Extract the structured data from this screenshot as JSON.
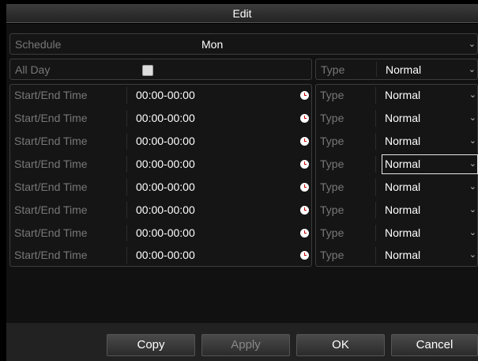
{
  "dialog": {
    "title": "Edit"
  },
  "schedule": {
    "label": "Schedule",
    "value": "Mon"
  },
  "allday": {
    "label": "All Day",
    "checked": false,
    "type_label": "Type",
    "type_value": "Normal"
  },
  "rows": [
    {
      "label": "Start/End Time",
      "time": "00:00-00:00",
      "type_label": "Type",
      "type_value": "Normal"
    },
    {
      "label": "Start/End Time",
      "time": "00:00-00:00",
      "type_label": "Type",
      "type_value": "Normal"
    },
    {
      "label": "Start/End Time",
      "time": "00:00-00:00",
      "type_label": "Type",
      "type_value": "Normal"
    },
    {
      "label": "Start/End Time",
      "time": "00:00-00:00",
      "type_label": "Type",
      "type_value": "Normal"
    },
    {
      "label": "Start/End Time",
      "time": "00:00-00:00",
      "type_label": "Type",
      "type_value": "Normal"
    },
    {
      "label": "Start/End Time",
      "time": "00:00-00:00",
      "type_label": "Type",
      "type_value": "Normal"
    },
    {
      "label": "Start/End Time",
      "time": "00:00-00:00",
      "type_label": "Type",
      "type_value": "Normal"
    },
    {
      "label": "Start/End Time",
      "time": "00:00-00:00",
      "type_label": "Type",
      "type_value": "Normal"
    }
  ],
  "buttons": {
    "copy": "Copy",
    "apply": "Apply",
    "ok": "OK",
    "cancel": "Cancel"
  }
}
